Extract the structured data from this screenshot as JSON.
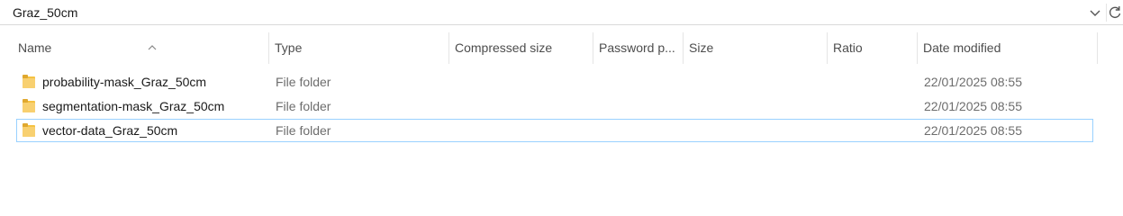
{
  "address_bar": {
    "path": "Graz_50cm",
    "chevron_icon": "chevron-right-icon",
    "dropdown_icon": "chevron-down-icon",
    "refresh_icon": "refresh-icon"
  },
  "columns": [
    {
      "label": "Name",
      "sorted": "ascending"
    },
    {
      "label": "Type"
    },
    {
      "label": "Compressed size"
    },
    {
      "label": "Password p..."
    },
    {
      "label": "Size"
    },
    {
      "label": "Ratio"
    },
    {
      "label": "Date modified"
    }
  ],
  "rows": [
    {
      "name": "probability-mask_Graz_50cm",
      "type": "File folder",
      "date_modified": "22/01/2025 08:55",
      "icon": "folder-icon"
    },
    {
      "name": "segmentation-mask_Graz_50cm",
      "type": "File folder",
      "date_modified": "22/01/2025 08:55",
      "icon": "folder-icon"
    },
    {
      "name": "vector-data_Graz_50cm",
      "type": "File folder",
      "date_modified": "22/01/2025 08:55",
      "icon": "folder-icon",
      "focused": true
    }
  ],
  "colors": {
    "folder": "#f5c242",
    "focus_border": "#99d1ff",
    "header_text": "#4d4d4d",
    "secondary_text": "#6d6d6d"
  }
}
